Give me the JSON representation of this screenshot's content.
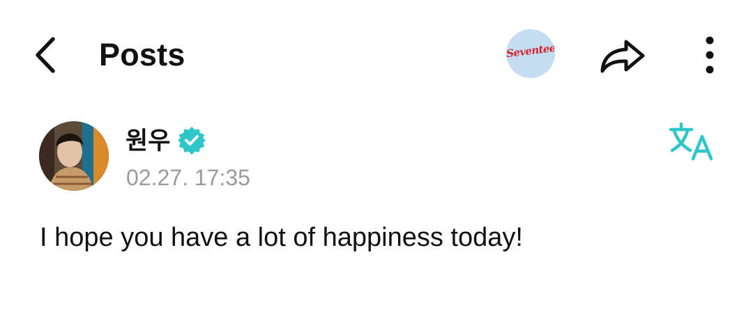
{
  "header": {
    "title": "Posts",
    "back_icon": "chevron-left-icon",
    "community_logo_text": "Seventeen",
    "share_icon": "share-icon",
    "more_icon": "more-vertical-icon"
  },
  "post": {
    "author": "원우",
    "verified_icon": "verified-badge-icon",
    "timestamp": "02.27. 17:35",
    "translate_icon": "translate-icon",
    "text": "I hope you have a lot of happiness today!"
  },
  "colors": {
    "accent_teal": "#2ec7c9",
    "timestamp_gray": "#9b9b9b",
    "logo_bg": "#c6dcf0",
    "logo_red": "#d3262e"
  }
}
